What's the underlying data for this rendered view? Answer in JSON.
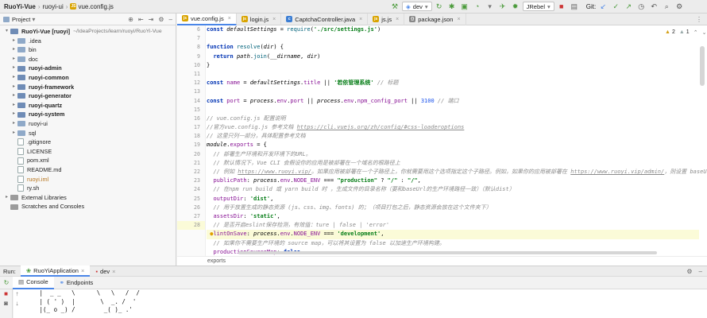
{
  "breadcrumbs": [
    "RuoYi-Vue",
    "ruoyi-ui",
    "vue.config.js"
  ],
  "toolbar": {
    "branch_combo": "dev",
    "jrebel_combo": "JRebel",
    "git_label": "Git:"
  },
  "project_panel": {
    "title": "Project",
    "items": [
      {
        "indent": 0,
        "arrow": "▾",
        "icon": "module",
        "name": "RuoYi-Vue [ruoyi]",
        "suffix": "~/IdeaProjects/learn/ruoyi/RuoYi-Vue",
        "bold": true
      },
      {
        "indent": 1,
        "arrow": "▸",
        "icon": "folder",
        "name": ".idea",
        "bold": false
      },
      {
        "indent": 1,
        "arrow": "▸",
        "icon": "folder",
        "name": "bin",
        "bold": false
      },
      {
        "indent": 1,
        "arrow": "▸",
        "icon": "folder",
        "name": "doc",
        "bold": false
      },
      {
        "indent": 1,
        "arrow": "▸",
        "icon": "module",
        "name": "ruoyi-admin",
        "bold": true
      },
      {
        "indent": 1,
        "arrow": "▸",
        "icon": "module",
        "name": "ruoyi-common",
        "bold": true
      },
      {
        "indent": 1,
        "arrow": "▸",
        "icon": "module",
        "name": "ruoyi-framework",
        "bold": true
      },
      {
        "indent": 1,
        "arrow": "▸",
        "icon": "module",
        "name": "ruoyi-generator",
        "bold": true
      },
      {
        "indent": 1,
        "arrow": "▸",
        "icon": "module",
        "name": "ruoyi-quartz",
        "bold": true
      },
      {
        "indent": 1,
        "arrow": "▸",
        "icon": "module",
        "name": "ruoyi-system",
        "bold": true
      },
      {
        "indent": 1,
        "arrow": "▸",
        "icon": "folder",
        "name": "ruoyi-ui",
        "bold": false
      },
      {
        "indent": 1,
        "arrow": "▸",
        "icon": "folder",
        "name": "sql",
        "bold": false
      },
      {
        "indent": 1,
        "arrow": "",
        "icon": "file",
        "name": ".gitignore",
        "bold": false
      },
      {
        "indent": 1,
        "arrow": "",
        "icon": "file",
        "name": "LICENSE",
        "bold": false
      },
      {
        "indent": 1,
        "arrow": "",
        "icon": "file",
        "name": "pom.xml",
        "bold": false
      },
      {
        "indent": 1,
        "arrow": "",
        "icon": "file",
        "name": "README.md",
        "bold": false
      },
      {
        "indent": 1,
        "arrow": "",
        "icon": "file",
        "name": "ruoyi.iml",
        "bold": false,
        "orange": true
      },
      {
        "indent": 1,
        "arrow": "",
        "icon": "file",
        "name": "ry.sh",
        "bold": false
      },
      {
        "indent": 0,
        "arrow": "▸",
        "icon": "lib",
        "name": "External Libraries",
        "bold": false
      },
      {
        "indent": 0,
        "arrow": "",
        "icon": "lib",
        "name": "Scratches and Consoles",
        "bold": false
      }
    ]
  },
  "editor_tabs": [
    {
      "label": "vue.config.js",
      "icon": "js",
      "color": "#d9a400",
      "active": true
    },
    {
      "label": "login.js",
      "icon": "js",
      "color": "#d9a400",
      "active": false
    },
    {
      "label": "CaptchaController.java",
      "icon": "c",
      "color": "#3d7fd4",
      "active": false
    },
    {
      "label": "js.js",
      "icon": "js",
      "color": "#d9a400",
      "active": false
    },
    {
      "label": "package.json",
      "icon": "{}",
      "color": "#888888",
      "active": false
    }
  ],
  "editor": {
    "warnings": "2",
    "weak_warnings": "1",
    "line_numbers": [
      "6",
      "7",
      "8",
      "9",
      "10",
      "11",
      "12",
      "13",
      "14",
      "15",
      "16",
      "17",
      "18",
      "19",
      "20",
      "21",
      "22",
      "23",
      "24",
      "25",
      "26",
      "27",
      "28"
    ],
    "highlight_line_index": 22,
    "breadcrumb": "exports"
  },
  "run_panel": {
    "label": "Run:",
    "tabs": [
      "RuoYiApplication",
      "dev"
    ],
    "subtabs": [
      "Console",
      "Endpoints"
    ],
    "console_lines": [
      " |  _ _   \\      \\   \\   /  /",
      " | ( ' )  |       \\  _. /  '",
      " |(_ o _) /        _( )_ .'"
    ]
  }
}
